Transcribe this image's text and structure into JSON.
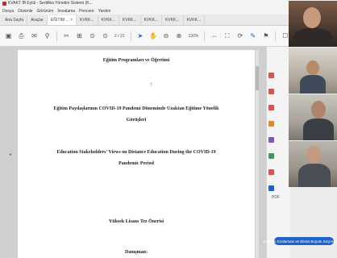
{
  "window": {
    "title": "KVAKT İB Eylül - Sertifika Yönetim Sistemi (K..."
  },
  "menu": [
    "Dosya",
    "Düzenle",
    "Görünüm",
    "İmzalama",
    "Pencere",
    "Yardım"
  ],
  "tabs": [
    {
      "label": "Ana Sayfa",
      "active": false
    },
    {
      "label": "Araçlar",
      "active": false
    },
    {
      "label": "EĞİTİM ... ×",
      "active": true
    },
    {
      "label": "KVKK...",
      "active": false
    },
    {
      "label": "KVKK...",
      "active": false
    },
    {
      "label": "KVKK...",
      "active": false
    },
    {
      "label": "KVKK...",
      "active": false
    },
    {
      "label": "KVKK...",
      "active": false
    },
    {
      "label": "KVKK...",
      "active": false
    }
  ],
  "toolbar": {
    "page_indicator": "2 / 31",
    "zoom": "130%"
  },
  "document": {
    "top_line": "Eğitim Programları ve Öğretimi",
    "title_tr_1": "Eğitim Paydaşlarının COVID-19 Pandemi Döneminde Uzaktan Eğitime Yönelik",
    "title_tr_2": "Görüşleri",
    "title_en_1": "Education Stakeholders' Views on Distance Education During the COVID-19",
    "title_en_2": "Pandemic Period",
    "thesis_type": "Yüksek Lisans Tez Önerisi",
    "advisor": "Danışman:"
  },
  "right_pane": {
    "pdf_label": "PDF"
  },
  "meeting": {
    "banner": "Görüntü Sıralaması ve Ekran Boyutu Seçimi Ayarla"
  },
  "colors": {
    "accent": "#1e63c9",
    "tool_red": "#d9534f",
    "tool_green": "#3c9a5f",
    "tool_purple": "#7e57c2",
    "tool_orange": "#e08a2b"
  }
}
